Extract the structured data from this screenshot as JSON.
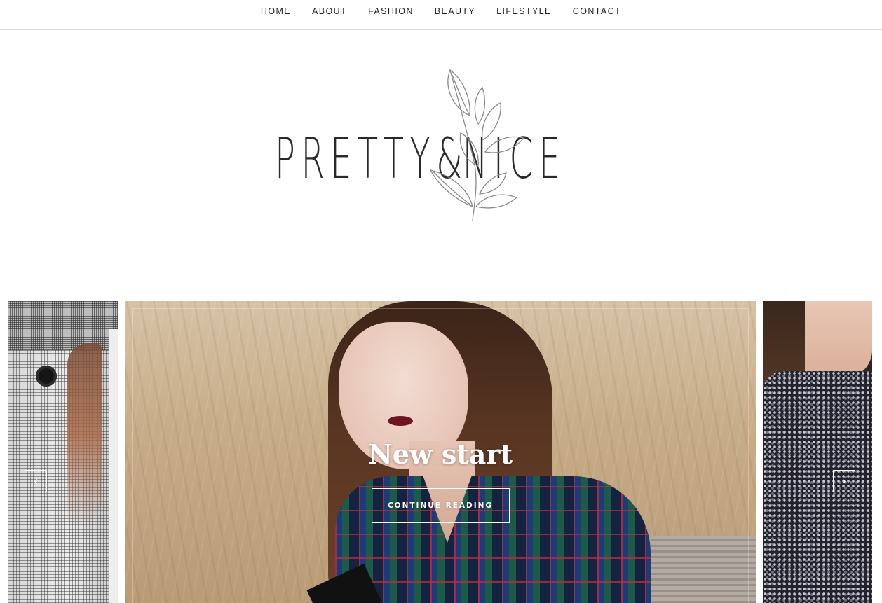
{
  "nav": {
    "items": [
      {
        "label": "HOME"
      },
      {
        "label": "ABOUT"
      },
      {
        "label": "FASHION"
      },
      {
        "label": "BEAUTY"
      },
      {
        "label": "LIFESTYLE"
      },
      {
        "label": "CONTACT"
      }
    ]
  },
  "logo": {
    "text_left": "PRETTY",
    "ampersand": "&",
    "text_right": "NICE",
    "icon": "leaf-branch-icon"
  },
  "slider": {
    "title": "New start",
    "button_label": "CONTINUE READING",
    "prev_icon": "‹",
    "next_icon": "›"
  },
  "colors": {
    "nav_text": "#222222",
    "logo_text": "#2a2a2a",
    "caption_text": "#ffffff"
  }
}
